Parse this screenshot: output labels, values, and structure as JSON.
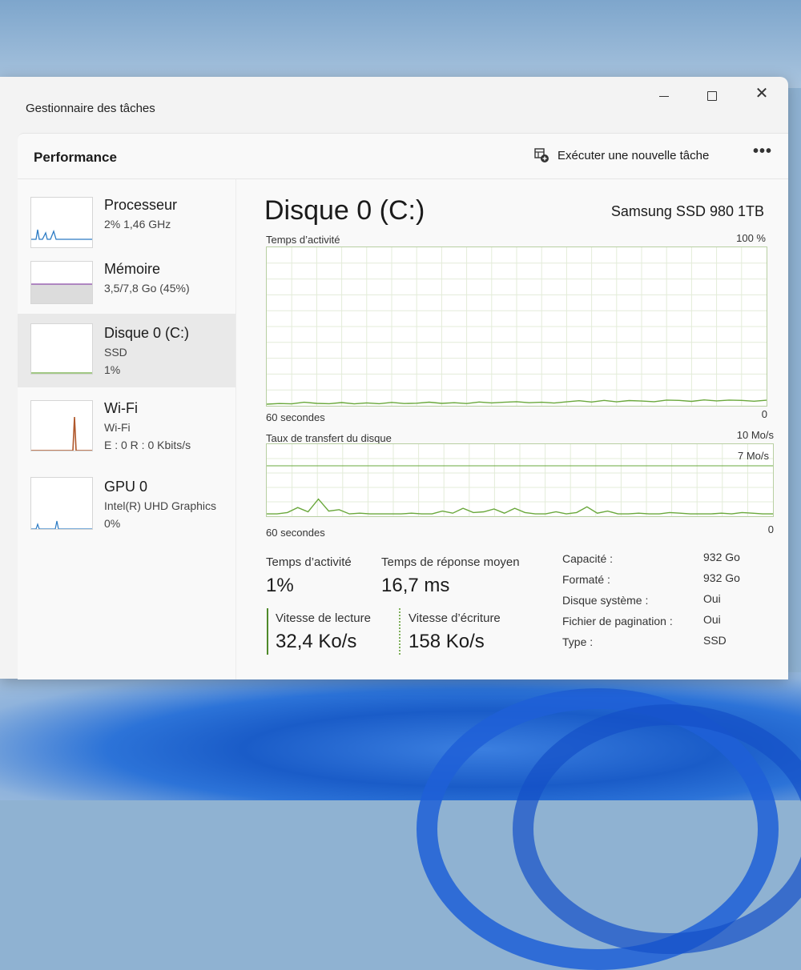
{
  "window": {
    "title": "Gestionnaire des tâches"
  },
  "header": {
    "title": "Performance",
    "run_task_label": "Exécuter une nouvelle tâche",
    "more_label": "•••"
  },
  "sidebar": {
    "items": [
      {
        "name": "Processeur",
        "sub1": "2% 1,46 GHz",
        "sub2": ""
      },
      {
        "name": "Mémoire",
        "sub1": "3,5/7,8 Go (45%)",
        "sub2": ""
      },
      {
        "name": "Disque 0 (C:)",
        "sub1": "SSD",
        "sub2": "1%"
      },
      {
        "name": "Wi-Fi",
        "sub1": "Wi-Fi",
        "sub2": "E : 0 R : 0 Kbits/s"
      },
      {
        "name": "GPU 0",
        "sub1": "Intel(R) UHD Graphics",
        "sub2": "0%"
      }
    ]
  },
  "main": {
    "title": "Disque 0 (C:)",
    "model": "Samsung SSD 980 1TB",
    "activity_graph": {
      "label": "Temps d’activité",
      "max_label": "100 %",
      "time_label": "60 secondes",
      "min_label": "0",
      "values": [
        0,
        0.4,
        0.2,
        1.2,
        0.5,
        0.3,
        1,
        0.2,
        0.8,
        0.3,
        1.1,
        0.4,
        0.6,
        1.3,
        0.5,
        0.9,
        0.4,
        1.4,
        0.8,
        1.2,
        1.6,
        0.9,
        1.2,
        0.7,
        1.5,
        2.2,
        1.4,
        2.4,
        1.5,
        2.3,
        2,
        1.6,
        2.6,
        2.4,
        1.8,
        2.7,
        2.1,
        2.6,
        2.4,
        1.9,
        2.5
      ]
    },
    "transfer_graph": {
      "label": "Taux de transfert du disque",
      "max_label": "10 Mo/s",
      "ref_label": "7 Mo/s",
      "ref_value": 7,
      "time_label": "60 secondes",
      "min_label": "0",
      "values": [
        0.1,
        0.1,
        0.3,
        1,
        0.4,
        2.2,
        0.5,
        0.7,
        0.1,
        0.2,
        0.1,
        0.1,
        0.1,
        0.1,
        0.2,
        0.1,
        0.1,
        0.5,
        0.2,
        0.9,
        0.3,
        0.4,
        0.8,
        0.2,
        0.9,
        0.3,
        0.1,
        0.1,
        0.4,
        0.1,
        0.3,
        1.1,
        0.2,
        0.5,
        0.1,
        0.1,
        0.2,
        0.1,
        0.1,
        0.3,
        0.2,
        0.1,
        0.1,
        0.1,
        0.2,
        0.1,
        0.3,
        0.2,
        0.1,
        0.1
      ]
    },
    "stats": {
      "activity_label": "Temps d’activité",
      "activity_value": "1%",
      "response_label": "Temps de réponse moyen",
      "response_value": "16,7 ms",
      "read_label": "Vitesse de lecture",
      "read_value": "32,4 Ko/s",
      "write_label": "Vitesse d’écriture",
      "write_value": "158 Ko/s"
    },
    "properties": [
      {
        "key": "Capacité :",
        "value": "932 Go"
      },
      {
        "key": "Formaté :",
        "value": "932 Go"
      },
      {
        "key": "Disque système :",
        "value": "Oui"
      },
      {
        "key": "Fichier de pagination :",
        "value": "Oui"
      },
      {
        "key": "Type :",
        "value": "SSD"
      }
    ]
  },
  "colors": {
    "disk_line": "#6aa83c",
    "cpu_line": "#2c7bc4",
    "memory_line": "#8a4aa8",
    "wifi_line": "#b0582c",
    "gpu_line": "#2c7bc4"
  }
}
